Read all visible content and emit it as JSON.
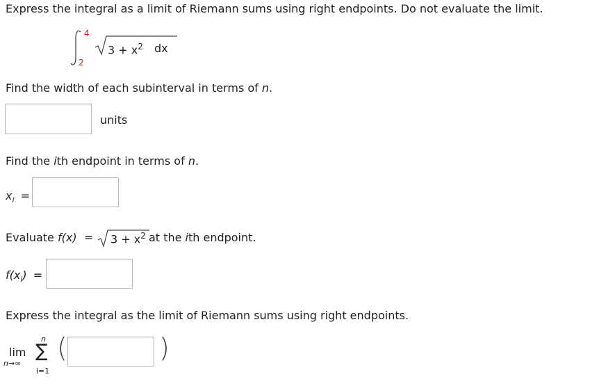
{
  "instruction": "Express the integral as a limit of Riemann sums using right endpoints. Do not evaluate the limit.",
  "integral": {
    "upper": "4",
    "lower": "2",
    "radicand_base": "3 + x",
    "exponent": "2",
    "differential": "dx"
  },
  "q1": {
    "prompt_pre": "Find the width of each subinterval in terms of ",
    "prompt_var": "n",
    "prompt_post": ".",
    "units": "units"
  },
  "q2": {
    "prompt_pre": "Find the ",
    "prompt_i": "i",
    "prompt_mid": "th endpoint in terms of ",
    "prompt_var": "n",
    "prompt_post": ".",
    "lhs_x": "x",
    "lhs_sub": "i",
    "eq": "="
  },
  "q3": {
    "prompt_pre": "Evaluate ",
    "f_expr": "f(x)",
    "eq": "=",
    "radicand_base": "3 + x",
    "exponent": "2",
    "prompt_post_pre": " at the ",
    "prompt_i": "i",
    "prompt_post": "th endpoint.",
    "lhs_f": "f(x",
    "lhs_sub": "i",
    "lhs_close": ")",
    "lhs_eq": "="
  },
  "q4": {
    "prompt": "Express the integral as the limit of Riemann sums using right endpoints.",
    "lim": "lim",
    "lim_sub_var": "n",
    "lim_sub_arrow": "→",
    "lim_sub_inf": "∞",
    "sum_symbol": "∑",
    "sum_upper": "n",
    "sum_lower": "i=1",
    "open_paren": "(",
    "close_paren": ")"
  }
}
